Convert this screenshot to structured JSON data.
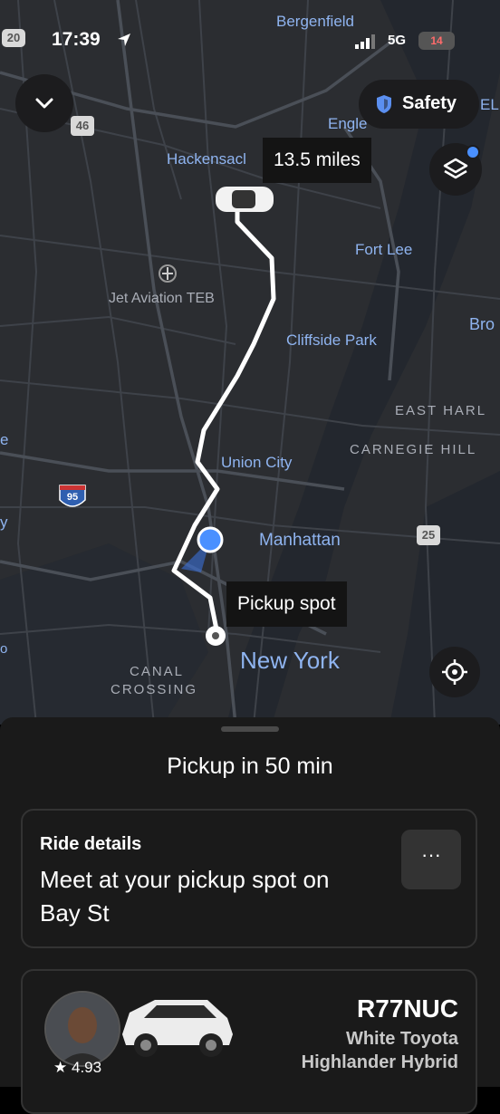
{
  "status_bar": {
    "time": "17:39",
    "network": "5G",
    "battery": "14",
    "road_badge": "20"
  },
  "map": {
    "labels": {
      "bergenfield": "Bergenfield",
      "englewood": "Engle",
      "hackensack": "Hackensacl",
      "fort_lee": "Fort Lee",
      "jet_aviation": "Jet Aviation TEB",
      "cliffside": "Cliffside Park",
      "bronx": "Bro",
      "east_harlem": "EAST HARL",
      "carnegie": "CARNEGIE HILL",
      "union_city": "Union City",
      "manhattan": "Manhattan",
      "new_york": "New York",
      "canal_crossing_1": "CANAL",
      "canal_crossing_2": "CROSSING",
      "edge_e": "e",
      "edge_y": "y",
      "edge_o": "o",
      "el": "EL"
    },
    "shields": {
      "i95": "95",
      "r46": "46",
      "r25": "25"
    },
    "distance_callout": "13.5 miles",
    "pickup_callout": "Pickup spot"
  },
  "controls": {
    "safety_label": "Safety"
  },
  "sheet": {
    "pickup_title": "Pickup in 50 min",
    "ride_details_label": "Ride details",
    "ride_message": "Meet at your pickup spot on Bay St",
    "more_label": "···",
    "driver": {
      "rating": "4.93",
      "plate": "R77NUC",
      "car_line1": "White Toyota",
      "car_line2": "Highlander Hybrid"
    }
  },
  "colors": {
    "map_bg": "#2b2d31",
    "route": "#ffffff",
    "water": "#1f2a33",
    "accent_blue": "#4a90ff",
    "sheet_bg": "#1a1a1a"
  }
}
